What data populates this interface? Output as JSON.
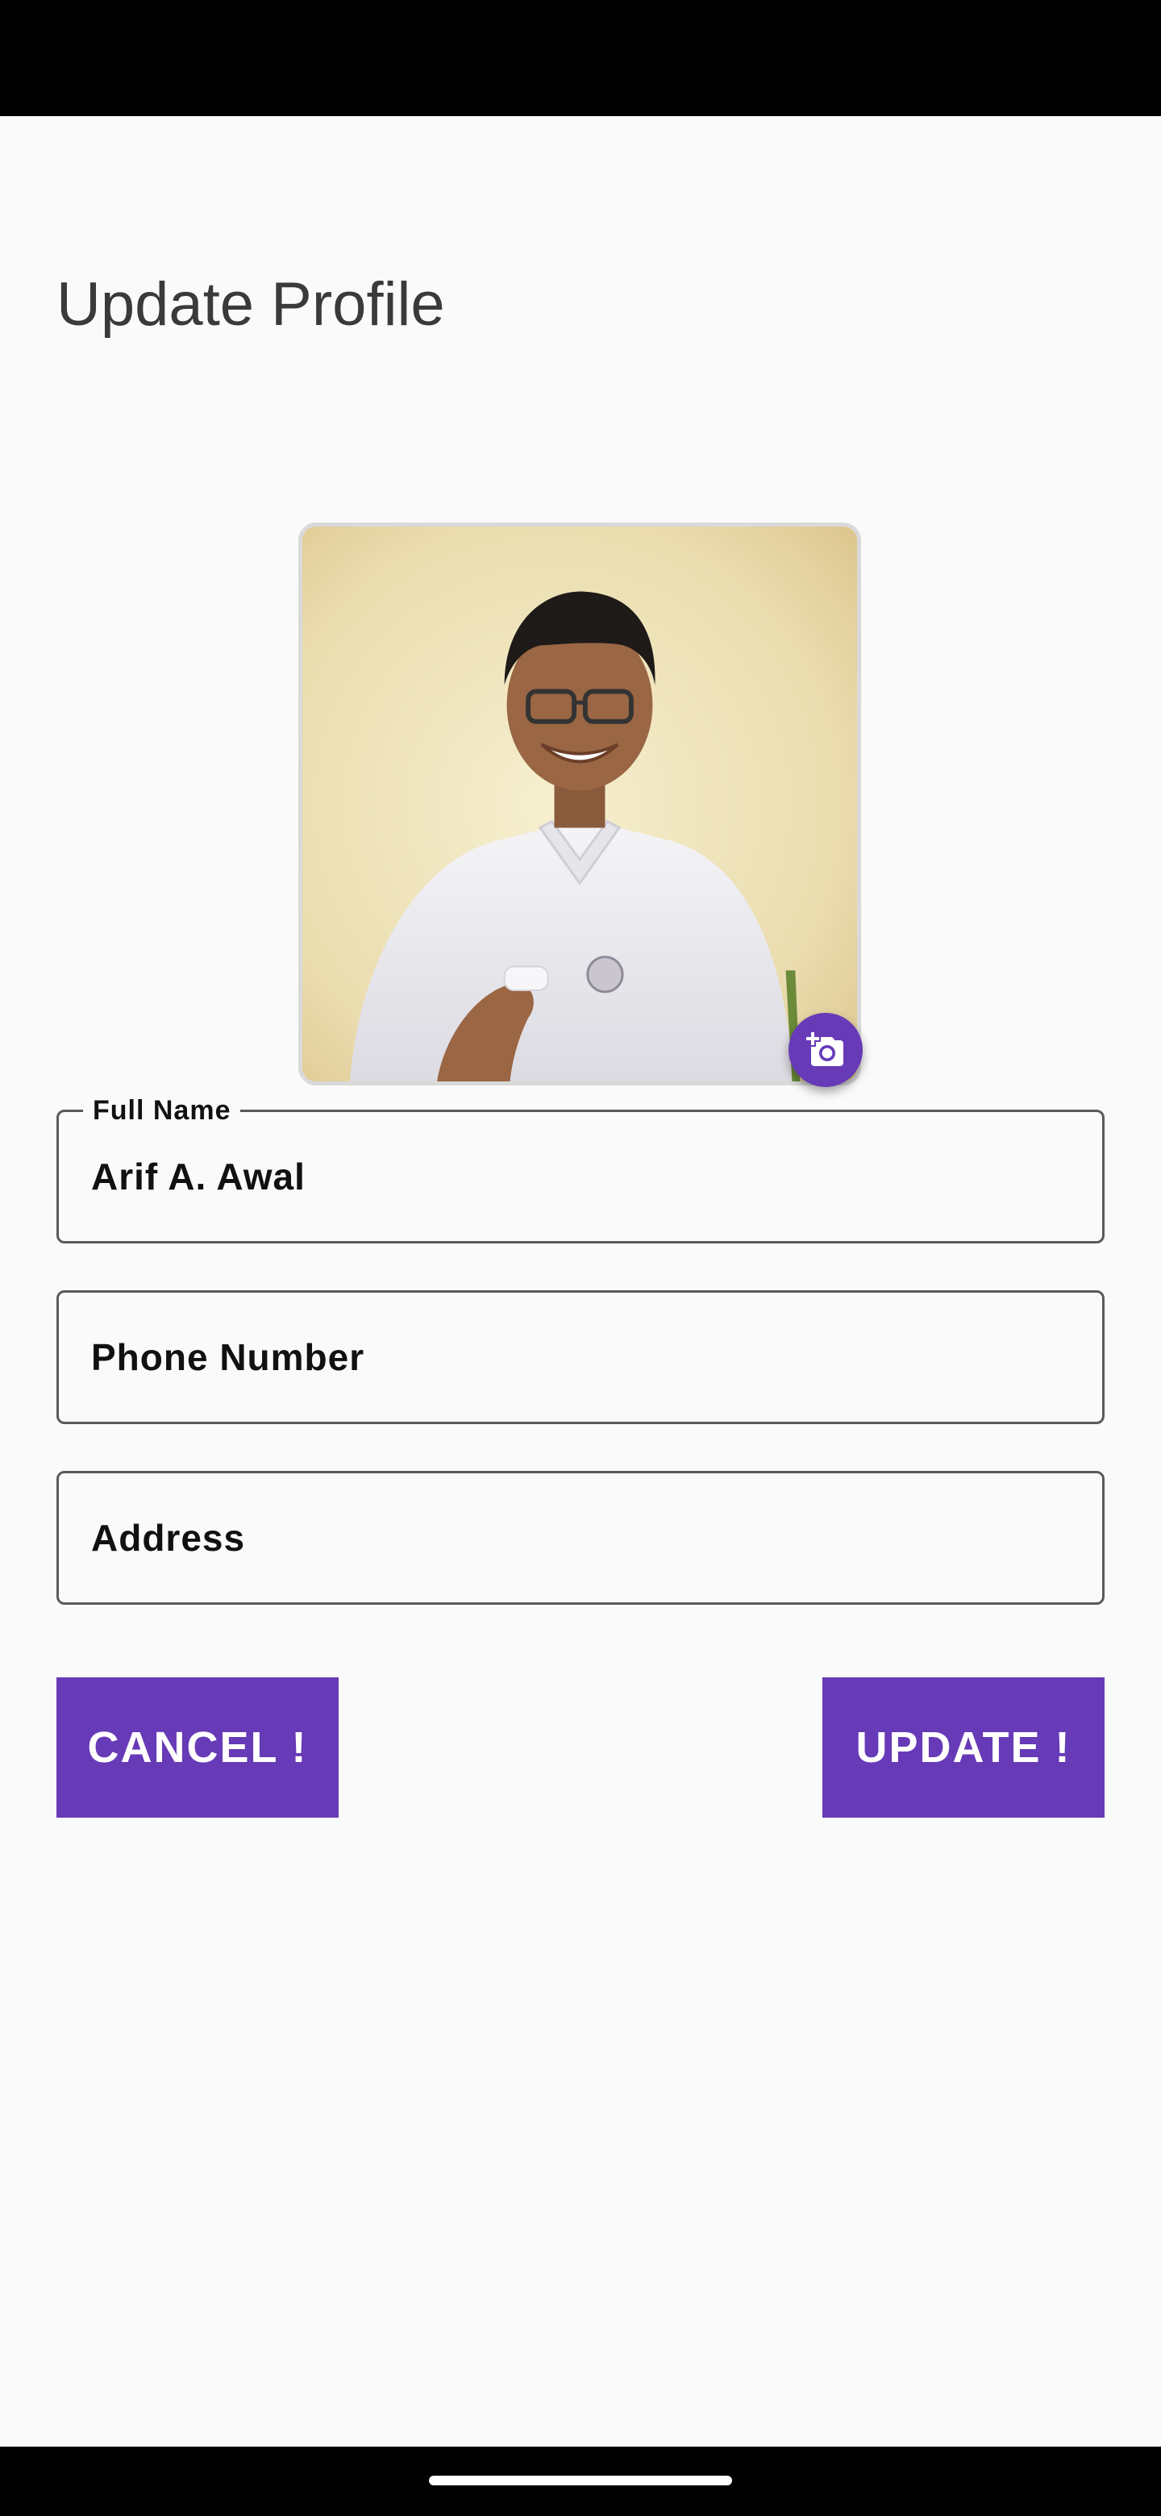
{
  "header": {
    "title": "Update Profile"
  },
  "profile_photo": {
    "camera_icon": "add-a-photo-icon"
  },
  "form": {
    "full_name": {
      "label": "Full Name",
      "value": "Arif A. Awal"
    },
    "phone": {
      "placeholder": "Phone Number",
      "value": ""
    },
    "address": {
      "placeholder": "Address",
      "value": ""
    }
  },
  "actions": {
    "cancel_label": "CANCEL !",
    "update_label": "UPDATE !"
  },
  "colors": {
    "accent": "#673ab7",
    "background": "#fafafa",
    "title_text": "#3a3a3a",
    "field_border": "#5a5a5a"
  }
}
